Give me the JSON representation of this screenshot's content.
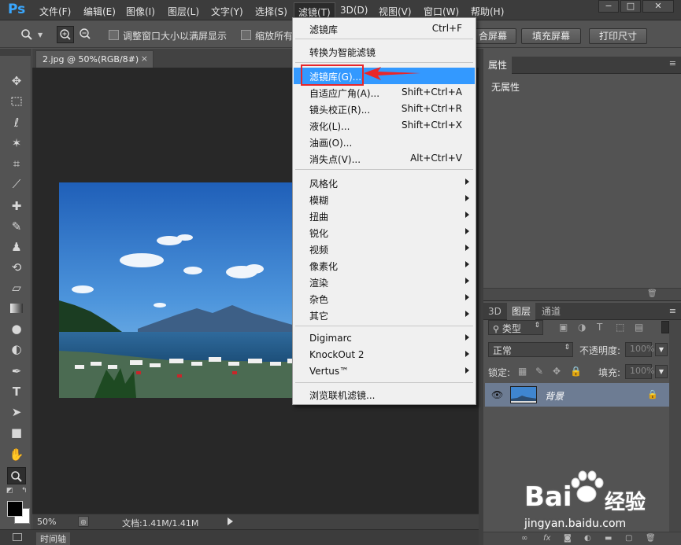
{
  "menubar": {
    "logo": "Ps",
    "items": [
      "文件(F)",
      "编辑(E)",
      "图像(I)",
      "图层(L)",
      "文字(Y)",
      "选择(S)",
      "滤镜(T)",
      "3D(D)",
      "视图(V)",
      "窗口(W)",
      "帮助(H)"
    ]
  },
  "window_controls": {
    "minimize": "−",
    "restore": "□",
    "close": "✕"
  },
  "options": {
    "checkbox1_label": "调整窗口大小以满屏显示",
    "checkbox2_label": "缩放所有",
    "btn_fit": "合屏幕",
    "btn_fill": "填充屏幕",
    "btn_print": "打印尺寸"
  },
  "document": {
    "tab_title": "2.jpg @ 50%(RGB/8#)",
    "tab_close": "×",
    "zoom": "50%",
    "doc_info": "文档:1.41M/1.41M"
  },
  "timeline_label": "时间轴",
  "filter_menu": {
    "top": [
      {
        "label": "滤镜库",
        "shortcut": "Ctrl+F"
      }
    ],
    "convert": "转换为智能滤镜",
    "group1": [
      {
        "label": "滤镜库(G)...",
        "shortcut": "",
        "highlighted": true
      },
      {
        "label": "自适应广角(A)...",
        "shortcut": "Shift+Ctrl+A"
      },
      {
        "label": "镜头校正(R)...",
        "shortcut": "Shift+Ctrl+R"
      },
      {
        "label": "液化(L)...",
        "shortcut": "Shift+Ctrl+X"
      },
      {
        "label": "油画(O)...",
        "shortcut": ""
      },
      {
        "label": "消失点(V)...",
        "shortcut": "Alt+Ctrl+V"
      }
    ],
    "group2": [
      "风格化",
      "模糊",
      "扭曲",
      "锐化",
      "视频",
      "像素化",
      "渲染",
      "杂色",
      "其它"
    ],
    "group3": [
      "Digimarc",
      "KnockOut 2",
      "Vertus™"
    ],
    "browse": "浏览联机滤镜..."
  },
  "properties_panel": {
    "tab": "属性",
    "empty_text": "无属性"
  },
  "layers_panel": {
    "tabs": [
      "3D",
      "图层",
      "通道"
    ],
    "filter_kind": "类型",
    "blend_mode": "正常",
    "opacity_label": "不透明度:",
    "opacity_value": "100%",
    "lock_label": "锁定:",
    "fill_label": "填充:",
    "fill_value": "100%",
    "layers": [
      {
        "name": "背景",
        "visible": true,
        "locked": true
      }
    ]
  },
  "watermark": {
    "brand": "Bai",
    "brand_suffix": "经验",
    "url": "jingyan.baidu.com"
  },
  "colors": {
    "menu_highlight": "#3399ff",
    "annotation_red": "#e8262a",
    "layer_selected": "#6d7c93"
  }
}
